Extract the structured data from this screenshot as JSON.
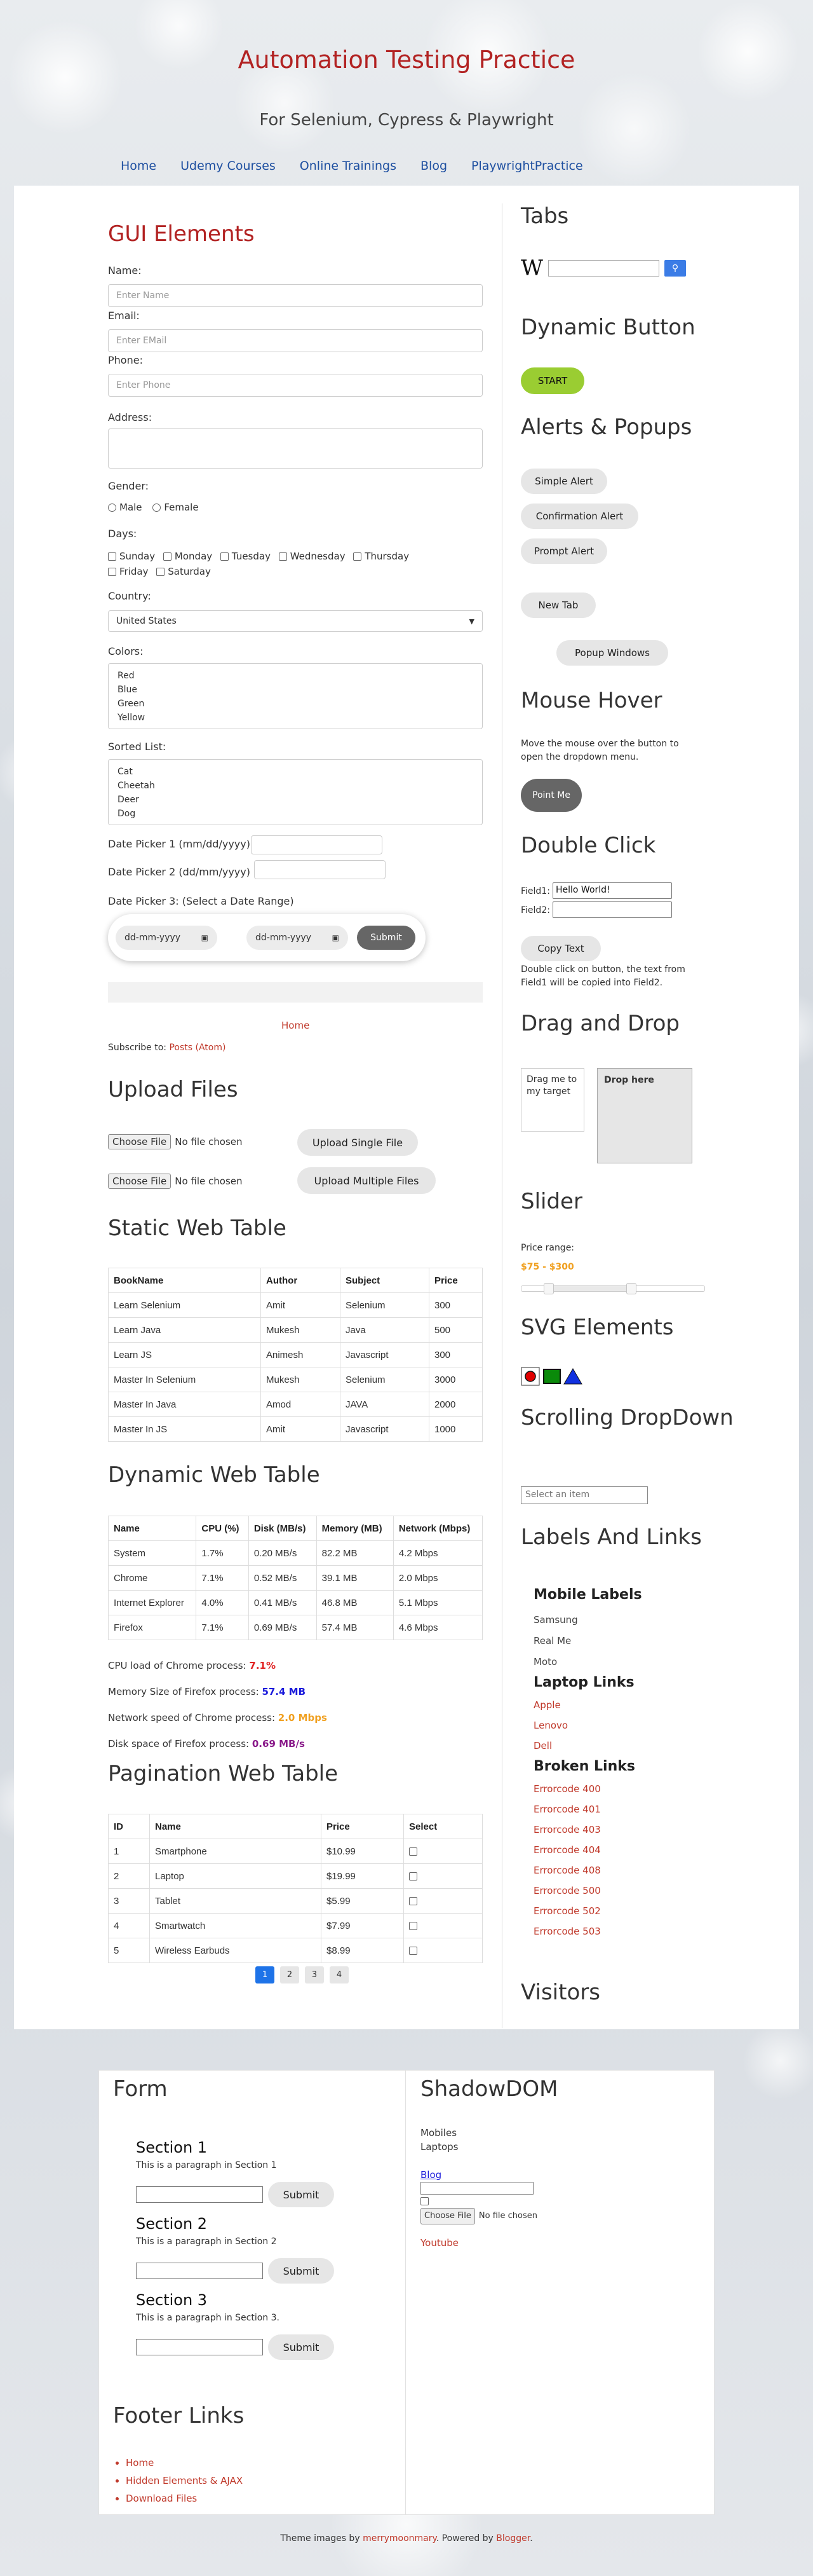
{
  "header": {
    "title": "Automation Testing Practice",
    "subtitle": "For Selenium, Cypress & Playwright",
    "nav": [
      "Home",
      "Udemy Courses",
      "Online Trainings",
      "Blog",
      "PlaywrightPractice"
    ]
  },
  "gui": {
    "title": "GUI Elements",
    "name_label": "Name:",
    "name_placeholder": "Enter Name",
    "email_label": "Email:",
    "email_placeholder": "Enter EMail",
    "phone_label": "Phone:",
    "phone_placeholder": "Enter Phone",
    "address_label": "Address:",
    "gender_label": "Gender:",
    "gender_options": [
      "Male",
      "Female"
    ],
    "days_label": "Days:",
    "days": [
      "Sunday",
      "Monday",
      "Tuesday",
      "Wednesday",
      "Thursday",
      "Friday",
      "Saturday"
    ],
    "country_label": "Country:",
    "country_selected": "United States",
    "colors_label": "Colors:",
    "colors": [
      "Red",
      "Blue",
      "Green",
      "Yellow"
    ],
    "sorted_label": "Sorted List:",
    "sorted": [
      "Cat",
      "Cheetah",
      "Deer",
      "Dog"
    ],
    "date1_label": "Date Picker 1 (mm/dd/yyyy):",
    "date2_label": "Date Picker 2 (dd/mm/yyyy) :",
    "date3_label": "Date Picker 3: (Select a Date Range)",
    "date_placeholder": "dd-mm-yyyy",
    "submit": "Submit"
  },
  "home_link": "Home",
  "subscribe": {
    "text": "Subscribe to: ",
    "link": "Posts (Atom)"
  },
  "upload": {
    "title": "Upload Files",
    "choose": "Choose File",
    "no_file": "No file chosen",
    "single": "Upload Single File",
    "multiple": "Upload Multiple Files"
  },
  "static_table": {
    "title": "Static Web Table",
    "headers": [
      "BookName",
      "Author",
      "Subject",
      "Price"
    ],
    "rows": [
      [
        "Learn Selenium",
        "Amit",
        "Selenium",
        "300"
      ],
      [
        "Learn Java",
        "Mukesh",
        "Java",
        "500"
      ],
      [
        "Learn JS",
        "Animesh",
        "Javascript",
        "300"
      ],
      [
        "Master In Selenium",
        "Mukesh",
        "Selenium",
        "3000"
      ],
      [
        "Master In Java",
        "Amod",
        "JAVA",
        "2000"
      ],
      [
        "Master In JS",
        "Amit",
        "Javascript",
        "1000"
      ]
    ]
  },
  "dynamic_table": {
    "title": "Dynamic Web Table",
    "headers": [
      "Name",
      "CPU (%)",
      "Disk (MB/s)",
      "Memory (MB)",
      "Network (Mbps)"
    ],
    "rows": [
      [
        "System",
        "1.7%",
        "0.20 MB/s",
        "82.2 MB",
        "4.2 Mbps"
      ],
      [
        "Chrome",
        "7.1%",
        "0.52 MB/s",
        "39.1 MB",
        "2.0 Mbps"
      ],
      [
        "Internet Explorer",
        "4.0%",
        "0.41 MB/s",
        "46.8 MB",
        "5.1 Mbps"
      ],
      [
        "Firefox",
        "7.1%",
        "0.69 MB/s",
        "57.4 MB",
        "4.6 Mbps"
      ]
    ],
    "notes": [
      {
        "text": "CPU load of Chrome process: ",
        "value": "7.1%",
        "color": "#e02020"
      },
      {
        "text": "Memory Size of Firefox process: ",
        "value": "57.4 MB",
        "color": "#1a1adb"
      },
      {
        "text": "Network speed of Chrome process: ",
        "value": "2.0 Mbps",
        "color": "#f0a020"
      },
      {
        "text": "Disk space of Firefox process: ",
        "value": "0.69 MB/s",
        "color": "#8a1a8a"
      }
    ]
  },
  "pagination": {
    "title": "Pagination Web Table",
    "headers": [
      "ID",
      "Name",
      "Price",
      "Select"
    ],
    "rows": [
      [
        "1",
        "Smartphone",
        "$10.99"
      ],
      [
        "2",
        "Laptop",
        "$19.99"
      ],
      [
        "3",
        "Tablet",
        "$5.99"
      ],
      [
        "4",
        "Smartwatch",
        "$7.99"
      ],
      [
        "5",
        "Wireless Earbuds",
        "$8.99"
      ]
    ],
    "pages": [
      "1",
      "2",
      "3",
      "4"
    ]
  },
  "sidebar": {
    "tabs_title": "Tabs",
    "wiki_logo": "W",
    "dynamic_title": "Dynamic Button",
    "start": "START",
    "alerts_title": "Alerts & Popups",
    "simple_alert": "Simple Alert",
    "confirm_alert": "Confirmation Alert",
    "prompt_alert": "Prompt Alert",
    "new_tab": "New Tab",
    "popup": "Popup Windows",
    "hover_title": "Mouse Hover",
    "hover_desc": "Move the mouse over the button to open the dropdown menu.",
    "point_me": "Point Me",
    "dbl_title": "Double Click",
    "field1": "Field1:",
    "field1_value": "Hello World!",
    "field2": "Field2:",
    "copy": "Copy Text",
    "dbl_desc": "Double click on button, the text from Field1 will be copied into Field2.",
    "drag_title": "Drag and Drop",
    "drag_me": "Drag me to my target",
    "drop_here": "Drop here",
    "slider_title": "Slider",
    "price_label": "Price range:",
    "price_value": "$75 - $300",
    "price_min": 75,
    "price_max": 300,
    "svg_title": "SVG Elements",
    "scroll_title": "Scrolling DropDown",
    "scroll_placeholder": "Select an item",
    "labels_title": "Labels And Links",
    "mobile_title": "Mobile Labels",
    "mobiles": [
      "Samsung",
      "Real Me",
      "Moto"
    ],
    "laptop_title": "Laptop Links",
    "laptops": [
      "Apple",
      "Lenovo",
      "Dell"
    ],
    "broken_title": "Broken Links",
    "broken": [
      "Errorcode 400",
      "Errorcode 401",
      "Errorcode 403",
      "Errorcode 404",
      "Errorcode 408",
      "Errorcode 500",
      "Errorcode 502",
      "Errorcode 503"
    ],
    "visitors_title": "Visitors"
  },
  "bottom": {
    "form_title": "Form",
    "sections": [
      {
        "title": "Section 1",
        "text": "This is a paragraph in Section 1"
      },
      {
        "title": "Section 2",
        "text": "This is a paragraph in Section 2"
      },
      {
        "title": "Section 3",
        "text": "This is a paragraph in Section 3."
      }
    ],
    "submit": "Submit",
    "footer_title": "Footer Links",
    "footer_links": [
      "Home",
      "Hidden Elements & AJAX",
      "Download Files"
    ],
    "shadow_title": "ShadowDOM",
    "shadow_lines": [
      "Mobiles",
      "Laptops"
    ],
    "shadow_blog": "Blog",
    "shadow_choose": "Choose File",
    "shadow_no_file": "No file chosen",
    "shadow_youtube": "Youtube"
  },
  "credits": {
    "prefix": "Theme images by ",
    "author": "merrymoonmary",
    "mid": ". Powered by ",
    "blogger": "Blogger",
    "suffix": "."
  }
}
